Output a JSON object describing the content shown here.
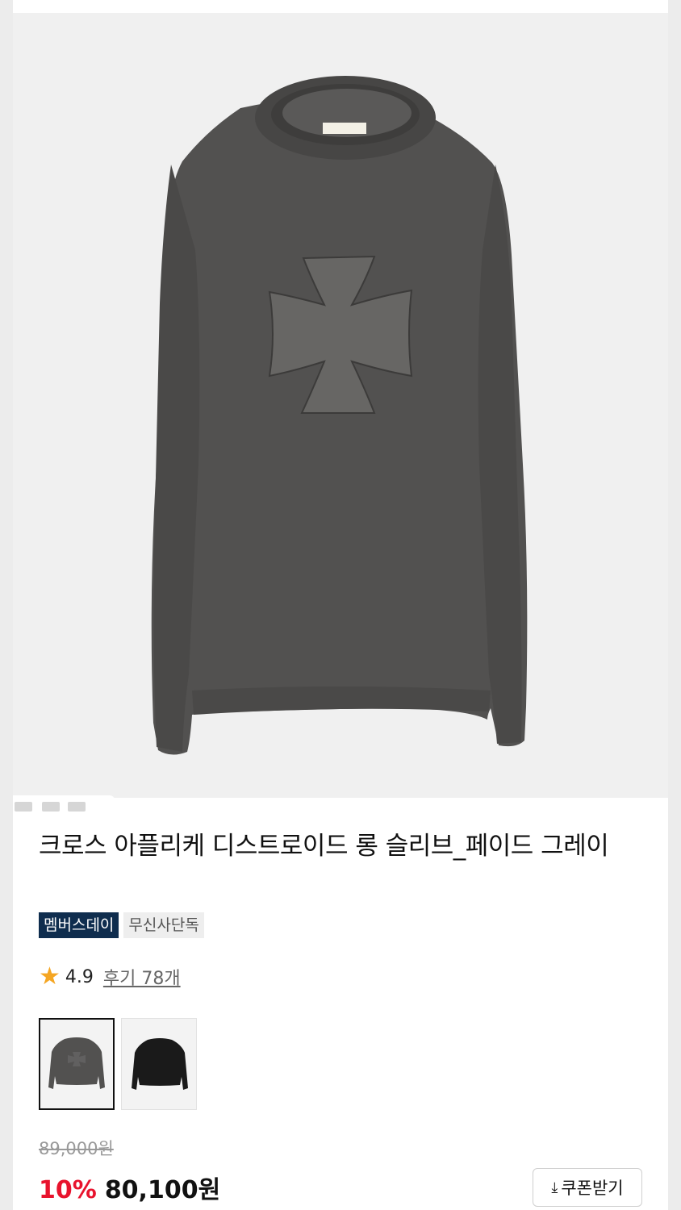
{
  "product": {
    "title": "크로스 아플리케 디스트로이드 롱 슬리브_페이드 그레이",
    "badges": [
      "멤버스데이",
      "무신사단독"
    ],
    "rating": {
      "score": "4.9",
      "reviews_label": "후기 78개"
    },
    "variants": [
      {
        "name": "faded-gray",
        "color": "#525150",
        "selected": true
      },
      {
        "name": "black",
        "color": "#1a1a1a",
        "selected": false
      }
    ],
    "original_price": "89,000원",
    "discount": "10%",
    "sale_price": "80,100원",
    "coupon_label": "쿠폰받기",
    "coupon_icon": "download-icon"
  },
  "colors": {
    "discount_red": "#e8132d",
    "badge_navy": "#0f2d4e",
    "star": "#f5a623",
    "shirt": "#525150"
  }
}
